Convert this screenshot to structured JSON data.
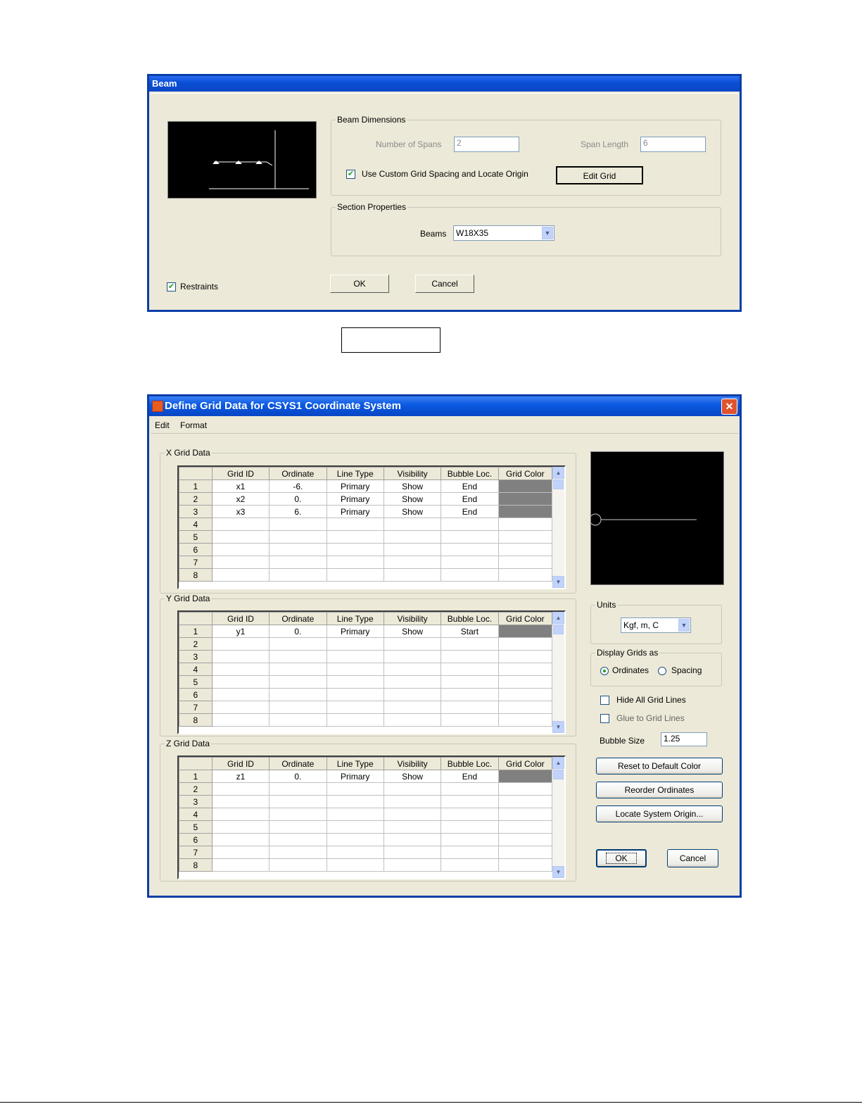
{
  "beam_dialog": {
    "title": "Beam",
    "beam_dimensions": {
      "group_label": "Beam Dimensions",
      "num_spans_label": "Number of Spans",
      "num_spans_value": "2",
      "span_length_label": "Span Length",
      "span_length_value": "6",
      "use_custom_grid_label": "Use Custom Grid Spacing and Locate Origin",
      "use_custom_grid_checked": true,
      "edit_grid_button": "Edit Grid"
    },
    "section_properties": {
      "group_label": "Section Properties",
      "beams_label": "Beams",
      "beams_value": "W18X35"
    },
    "restraints_label": "Restraints",
    "restraints_checked": true,
    "ok_button": "OK",
    "cancel_button": "Cancel"
  },
  "caption_box": "",
  "grid_dialog": {
    "title": "Define Grid Data for CSYS1 Coordinate System",
    "menu": [
      "Edit",
      "Format"
    ],
    "columns": [
      "",
      "Grid ID",
      "Ordinate",
      "Line Type",
      "Visibility",
      "Bubble Loc.",
      "Grid Color"
    ],
    "x_grid": {
      "label": "X Grid Data",
      "rows": [
        [
          "1",
          "x1",
          "-6.",
          "Primary",
          "Show",
          "End",
          ""
        ],
        [
          "2",
          "x2",
          "0.",
          "Primary",
          "Show",
          "End",
          ""
        ],
        [
          "3",
          "x3",
          "6.",
          "Primary",
          "Show",
          "End",
          ""
        ],
        [
          "4",
          "",
          "",
          "",
          "",
          "",
          ""
        ],
        [
          "5",
          "",
          "",
          "",
          "",
          "",
          ""
        ],
        [
          "6",
          "",
          "",
          "",
          "",
          "",
          ""
        ],
        [
          "7",
          "",
          "",
          "",
          "",
          "",
          ""
        ],
        [
          "8",
          "",
          "",
          "",
          "",
          "",
          ""
        ]
      ],
      "filled_rows": 3
    },
    "y_grid": {
      "label": "Y Grid Data",
      "rows": [
        [
          "1",
          "y1",
          "0.",
          "Primary",
          "Show",
          "Start",
          ""
        ],
        [
          "2",
          "",
          "",
          "",
          "",
          "",
          ""
        ],
        [
          "3",
          "",
          "",
          "",
          "",
          "",
          ""
        ],
        [
          "4",
          "",
          "",
          "",
          "",
          "",
          ""
        ],
        [
          "5",
          "",
          "",
          "",
          "",
          "",
          ""
        ],
        [
          "6",
          "",
          "",
          "",
          "",
          "",
          ""
        ],
        [
          "7",
          "",
          "",
          "",
          "",
          "",
          ""
        ],
        [
          "8",
          "",
          "",
          "",
          "",
          "",
          ""
        ]
      ],
      "filled_rows": 1
    },
    "z_grid": {
      "label": "Z Grid Data",
      "rows": [
        [
          "1",
          "z1",
          "0.",
          "Primary",
          "Show",
          "End",
          ""
        ],
        [
          "2",
          "",
          "",
          "",
          "",
          "",
          ""
        ],
        [
          "3",
          "",
          "",
          "",
          "",
          "",
          ""
        ],
        [
          "4",
          "",
          "",
          "",
          "",
          "",
          ""
        ],
        [
          "5",
          "",
          "",
          "",
          "",
          "",
          ""
        ],
        [
          "6",
          "",
          "",
          "",
          "",
          "",
          ""
        ],
        [
          "7",
          "",
          "",
          "",
          "",
          "",
          ""
        ],
        [
          "8",
          "",
          "",
          "",
          "",
          "",
          ""
        ]
      ],
      "filled_rows": 1
    },
    "units": {
      "label": "Units",
      "value": "Kgf, m, C"
    },
    "display_grids": {
      "label": "Display Grids as",
      "ordinates": "Ordinates",
      "spacing": "Spacing",
      "selected": "ordinates"
    },
    "hide_all_grid_lines": "Hide All Grid Lines",
    "glue_to_grid_lines": "Glue to Grid Lines",
    "bubble_size_label": "Bubble Size",
    "bubble_size_value": "1.25",
    "reset_color_button": "Reset to Default Color",
    "reorder_button": "Reorder Ordinates",
    "locate_origin_button": "Locate System Origin...",
    "ok_button": "OK",
    "cancel_button": "Cancel"
  },
  "colors": {
    "title_blue": "#0a46c7",
    "dialog_bg": "#ece9d8",
    "grid_color_cell": "#808080",
    "check_green": "#21a121"
  }
}
